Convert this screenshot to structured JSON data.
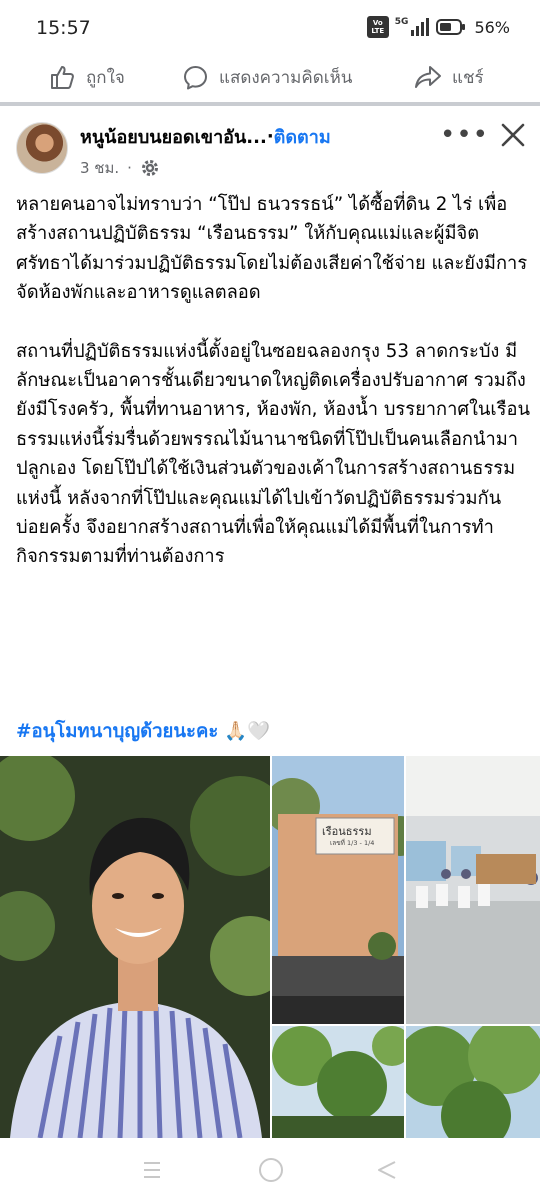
{
  "status": {
    "time": "15:57",
    "volte_top": "Vo",
    "volte_bottom": "LTE",
    "network": "5G",
    "battery": "56%"
  },
  "actions": {
    "like": "ถูกใจ",
    "comment": "แสดงความคิดเห็น",
    "share": "แชร์"
  },
  "post": {
    "author": "หนูน้อยบนยอดเขาอัน...",
    "separator": " · ",
    "follow": "ติดตาม",
    "time": "3 ชม.",
    "paragraphs": [
      "หลายคนอาจไม่ทราบว่า “โป๊ป ธนวรรธน์” ได้ซื้อที่ดิน 2 ไร่ เพื่อสร้างสถานปฏิบัติธรรม “เรือนธรรม” ให้กับคุณแม่และผู้มีจิตศรัทธาได้มาร่วมปฏิบัติธรรมโดยไม่ต้องเสียค่าใช้จ่าย และยังมีการจัดห้องพักและอาหารดูแลตลอด",
      "สถานที่ปฏิบัติธรรมแห่งนี้ตั้งอยู่ในซอยฉลองกรุง 53 ลาดกระบัง มีลักษณะเป็นอาคารชั้นเดียวขนาดใหญ่ติดเครื่องปรับอากาศ รวมถึงยังมีโรงครัว, พื้นที่ทานอาหาร, ห้องพัก, ห้องน้ำ บรรยากาศในเรือนธรรมแห่งนี้ร่มรื่นด้วยพรรณไม้นานาชนิดที่โป๊ปเป็นคนเลือกนำมาปลูกเอง โดยโป๊ปได้ใช้เงินส่วนตัวของเค้าในการสร้างสถานธรรมแห่งนี้ หลังจากที่โป๊ปและคุณแม่ได้ไปเข้าวัดปฏิบัติธรรมร่วมกันบ่อยครั้ง จึงอยากสร้างสถานที่เพื่อให้คุณแม่ได้มีพื้นที่ในการทำกิจกรรมตามที่ท่านต้องการ"
    ],
    "hashtag": "#อนุโมทนาบุญด้วยนะคะ",
    "hashtag_emoji": " 🙏🏻🤍",
    "sign_text": "เรือนธรรม",
    "sign_subtext": "เลขที่ 1/3 - 1/4"
  },
  "colors": {
    "accent": "#1877f2",
    "secondary_text": "#65676b",
    "divider": "#c9ccd1"
  }
}
